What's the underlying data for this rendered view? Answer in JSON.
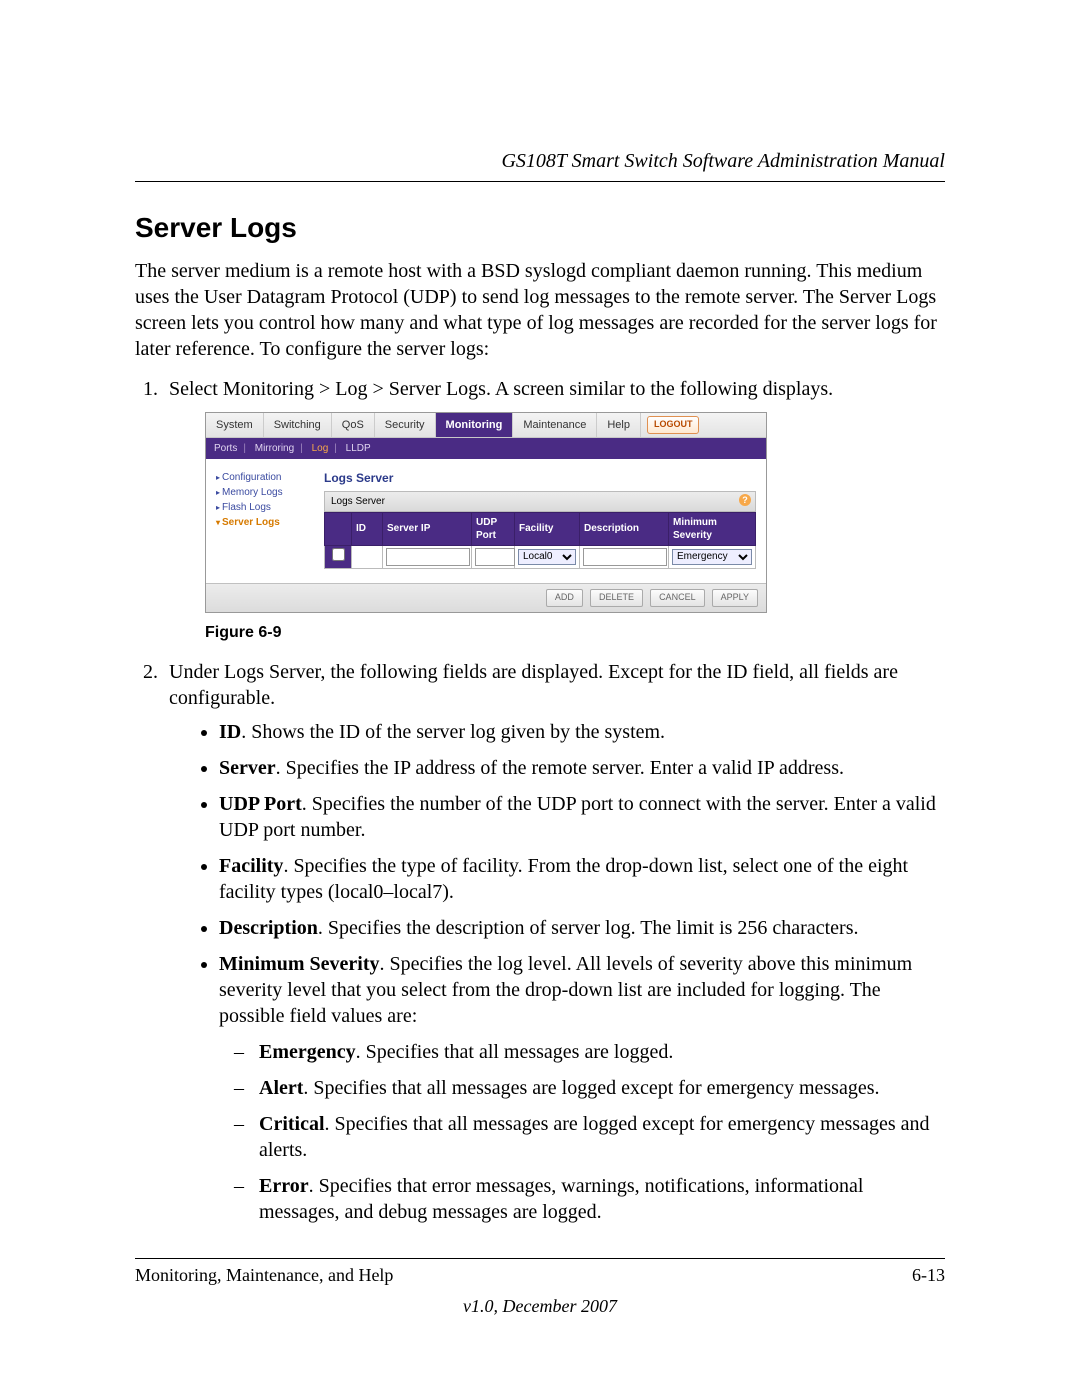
{
  "doc_header": "GS108T Smart Switch Software Administration Manual",
  "section_title": "Server Logs",
  "intro": "The server medium is a remote host with a BSD syslogd compliant daemon running. This medium uses the User Datagram Protocol (UDP) to send log messages to the remote server. The Server Logs screen lets you control how many and what type of log messages are recorded for the server logs for later reference. To configure the server logs:",
  "step1": "Select Monitoring > Log > Server Logs. A screen similar to the following displays.",
  "figure_caption": "Figure 6-9",
  "step2_lead": "Under Logs Server, the following fields are displayed. Except for the ID field, all fields are configurable.",
  "fields": {
    "id_b": "ID",
    "id_t": ". Shows the ID of the server log given by the system.",
    "server_b": "Server",
    "server_t": ". Specifies the IP address of the remote server. Enter a valid IP address.",
    "udp_b": "UDP Port",
    "udp_t": ". Specifies the number of the UDP port to connect with the server. Enter a valid UDP port number.",
    "fac_b": "Facility",
    "fac_t": ". Specifies the type of facility. From the drop-down list, select one of the eight facility types (local0–local7).",
    "desc_b": "Description",
    "desc_t": ". Specifies the description of server log. The limit is 256 characters.",
    "min_b": "Minimum Severity",
    "min_t": ". Specifies the log level. All levels of severity above this minimum severity level that you select from the drop-down list are included for logging. The possible field values are:"
  },
  "sev": {
    "emer_b": "Emergency",
    "emer_t": ". Specifies that all messages are logged.",
    "alert_b": "Alert",
    "alert_t": ". Specifies that all messages are logged except for emergency messages.",
    "crit_b": "Critical",
    "crit_t": ". Specifies that all messages are logged except for emergency messages and alerts.",
    "err_b": "Error",
    "err_t": ". Specifies that error messages, warnings, notifications, informational messages, and debug messages are logged."
  },
  "footer": {
    "left": "Monitoring, Maintenance, and Help",
    "right": "6-13",
    "version": "v1.0, December 2007"
  },
  "shot": {
    "tabs": [
      "System",
      "Switching",
      "QoS",
      "Security",
      "Monitoring",
      "Maintenance",
      "Help"
    ],
    "active_tab": "Monitoring",
    "logout": "LOGOUT",
    "subnav": [
      "Ports",
      "Mirroring",
      "Log",
      "LLDP"
    ],
    "subnav_active": "Log",
    "sidebar": [
      "Configuration",
      "Memory Logs",
      "Flash Logs",
      "Server Logs"
    ],
    "sidebar_active": "Server Logs",
    "panel_title": "Logs Server",
    "table_title": "Logs Server",
    "cols": {
      "id": "ID",
      "ip": "Server IP",
      "udp": "UDP Port",
      "fac": "Facility",
      "desc": "Description",
      "min": "Minimum Severity"
    },
    "facility_sel": "Local0",
    "severity_sel": "Emergency",
    "buttons": [
      "ADD",
      "DELETE",
      "CANCEL",
      "APPLY"
    ]
  }
}
